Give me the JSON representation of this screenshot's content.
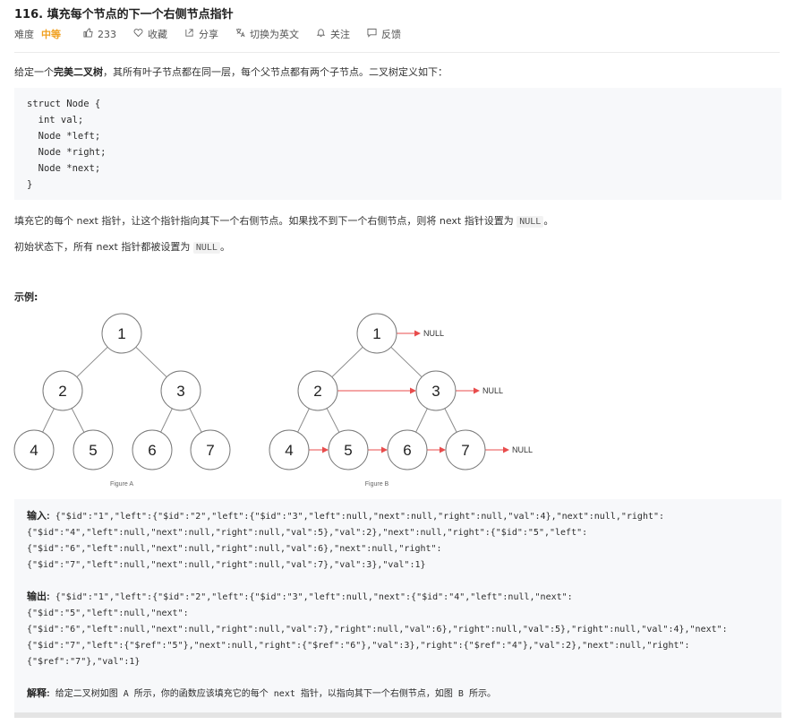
{
  "header": {
    "title": "116. 填充每个节点的下一个右侧节点指针",
    "difficulty_label": "难度",
    "difficulty": "中等",
    "likes": "233",
    "favorite": "收藏",
    "share": "分享",
    "switch_lang": "切换为英文",
    "follow": "关注",
    "feedback": "反馈"
  },
  "description": {
    "p1_pre": "给定一个",
    "p1_bold": "完美二叉树",
    "p1_post": "，其所有叶子节点都在同一层，每个父节点都有两个子节点。二叉树定义如下：",
    "code_lines": [
      "struct Node {",
      "  int val;",
      "  Node *left;",
      "  Node *right;",
      "  Node *next;",
      "}"
    ],
    "p2_pre": "填充它的每个 next 指针，让这个指针指向其下一个右侧节点。如果找不到下一个右侧节点，则将 next 指针设置为 ",
    "p2_code": "NULL",
    "p2_post": "。",
    "p3_pre": "初始状态下，所有 next 指针都被设置为 ",
    "p3_code": "NULL",
    "p3_post": "。"
  },
  "example": {
    "title": "示例:",
    "figure_a": {
      "caption": "Figure A",
      "nodes": [
        "1",
        "2",
        "3",
        "4",
        "5",
        "6",
        "7"
      ]
    },
    "figure_b": {
      "caption": "Figure B",
      "nodes": [
        "1",
        "2",
        "3",
        "4",
        "5",
        "6",
        "7"
      ],
      "null_label": "NULL"
    },
    "input_label": "输入:",
    "input_lines": [
      "{\"$id\":\"1\",\"left\":{\"$id\":\"2\",\"left\":{\"$id\":\"3\",\"left\":null,\"next\":null,\"right\":null,\"val\":4},\"next\":null,\"right\":",
      "{\"$id\":\"4\",\"left\":null,\"next\":null,\"right\":null,\"val\":5},\"val\":2},\"next\":null,\"right\":{\"$id\":\"5\",\"left\":",
      "{\"$id\":\"6\",\"left\":null,\"next\":null,\"right\":null,\"val\":6},\"next\":null,\"right\":",
      "{\"$id\":\"7\",\"left\":null,\"next\":null,\"right\":null,\"val\":7},\"val\":3},\"val\":1}"
    ],
    "output_label": "输出:",
    "output_lines": [
      "{\"$id\":\"1\",\"left\":{\"$id\":\"2\",\"left\":{\"$id\":\"3\",\"left\":null,\"next\":{\"$id\":\"4\",\"left\":null,\"next\":",
      "{\"$id\":\"5\",\"left\":null,\"next\":",
      "{\"$id\":\"6\",\"left\":null,\"next\":null,\"right\":null,\"val\":7},\"right\":null,\"val\":6},\"right\":null,\"val\":5},\"right\":null,\"val\":4},\"next\":",
      "{\"$id\":\"7\",\"left\":{\"$ref\":\"5\"},\"next\":null,\"right\":{\"$ref\":\"6\"},\"val\":3},\"right\":{\"$ref\":\"4\"},\"val\":2},\"next\":null,\"right\":",
      "{\"$ref\":\"7\"},\"val\":1}"
    ],
    "explain_label": "解释:",
    "explain_text": "给定二叉树如图 A 所示，你的函数应该填充它的每个 next 指针，以指向其下一个右侧节点，如图 B 所示。"
  },
  "colors": {
    "difficulty": "#f0a020",
    "arrow": "#e84c4c"
  }
}
